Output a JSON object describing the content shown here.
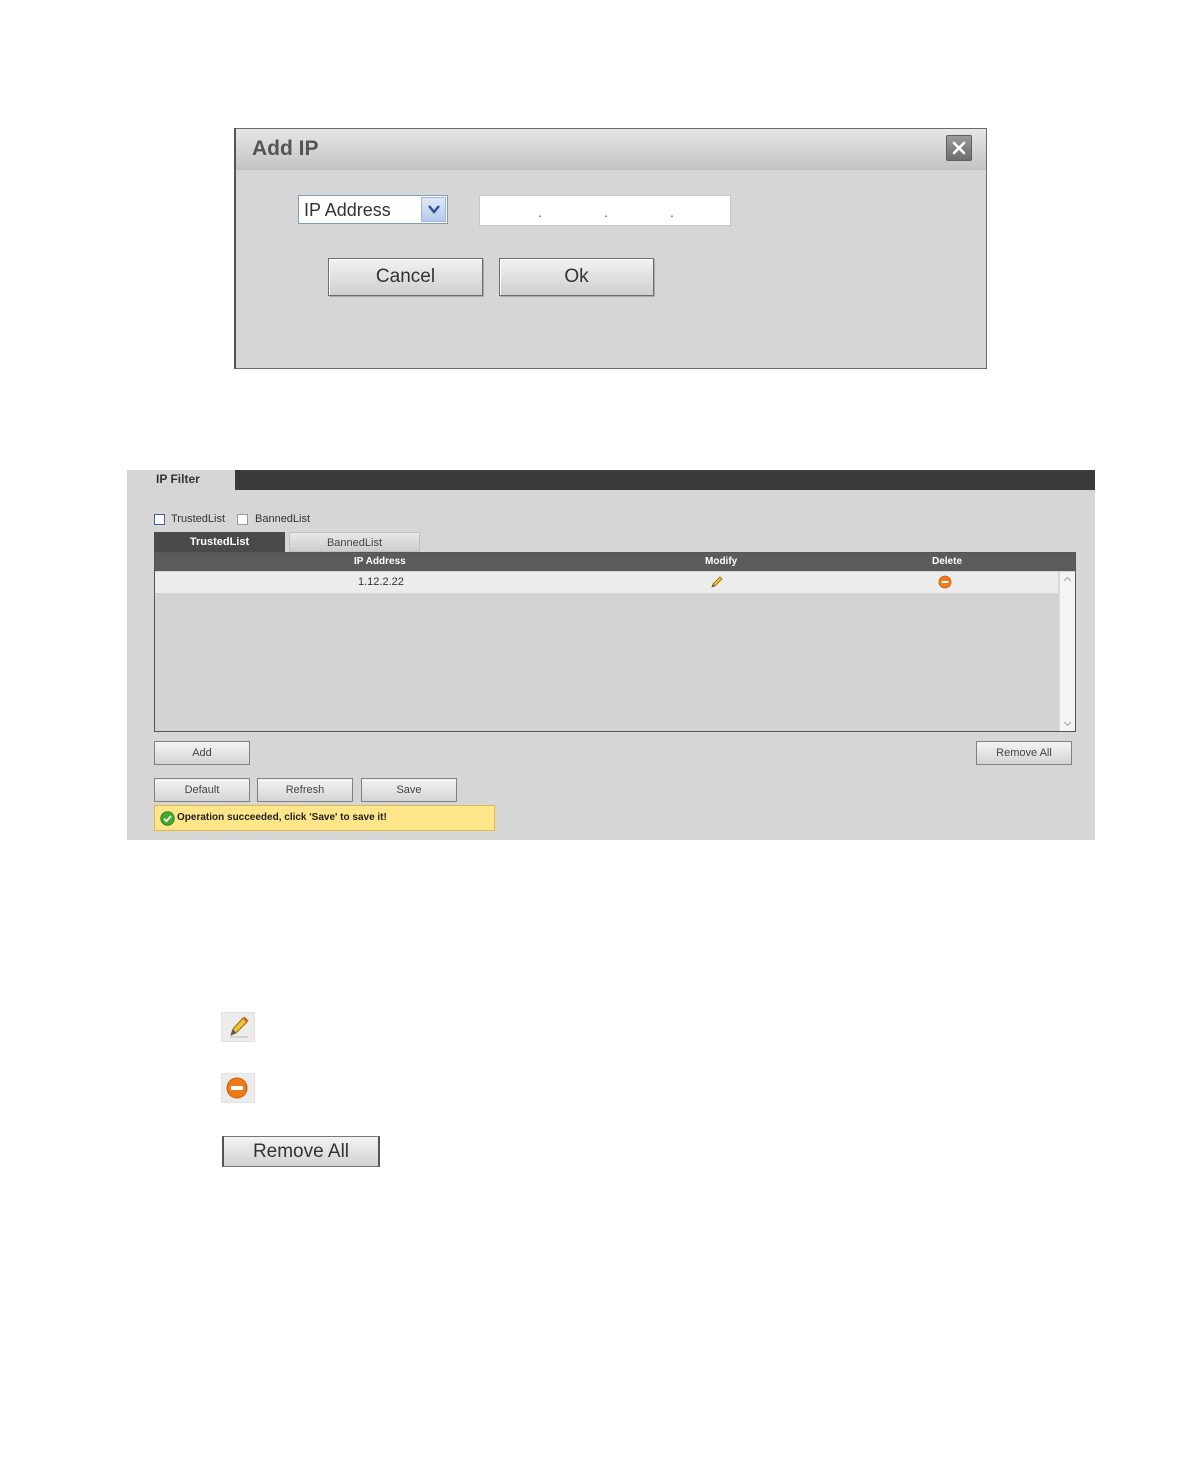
{
  "add_ip_dialog": {
    "title": "Add IP",
    "close_icon": "close-icon",
    "type_select": {
      "selected": "IP Address"
    },
    "ip_field": {
      "separators": [
        ".",
        ".",
        "."
      ]
    },
    "cancel_label": "Cancel",
    "ok_label": "Ok"
  },
  "ip_filter": {
    "tab_title": "IP Filter",
    "checkboxes": [
      {
        "label": "TrustedList",
        "checked": false
      },
      {
        "label": "BannedList",
        "checked": false
      }
    ],
    "list_tabs": [
      {
        "label": "TrustedList",
        "active": true
      },
      {
        "label": "BannedList",
        "active": false
      }
    ],
    "table": {
      "columns": [
        "IP Address",
        "Modify",
        "Delete"
      ],
      "rows": [
        {
          "ip": "1.12.2.22",
          "modify_icon": "pencil-icon",
          "delete_icon": "delete-icon"
        }
      ]
    },
    "add_label": "Add",
    "remove_all_label": "Remove All",
    "default_label": "Default",
    "refresh_label": "Refresh",
    "save_label": "Save",
    "status_message": "Operation succeeded, click 'Save' to save it!",
    "status_icon": "check-icon"
  },
  "legend": {
    "modify_icon": "pencil-icon",
    "delete_icon": "delete-icon",
    "remove_all_label": "Remove All"
  },
  "colors": {
    "panel_bg": "#d6d6d6",
    "header_dark": "#3b3b3b",
    "status_bg": "#fde68a",
    "delete_orange": "#f07a1a"
  }
}
